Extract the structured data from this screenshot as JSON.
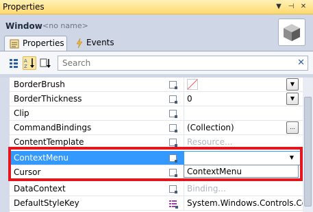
{
  "panel": {
    "title": "Properties",
    "pin_glyph": "▼",
    "dock_glyph": "⊣",
    "close_glyph": "✕"
  },
  "object": {
    "type": "Window",
    "name": "<no name>"
  },
  "tabs": [
    {
      "label": "Properties",
      "icon": "properties-icon",
      "active": true
    },
    {
      "label": "Events",
      "icon": "lightning-icon",
      "active": false
    }
  ],
  "toolbar": {
    "search_placeholder": "Search",
    "clear_glyph": "✕"
  },
  "grid": {
    "rows": [
      {
        "name": "BorderBrush",
        "value": "",
        "editor": "dropdown"
      },
      {
        "name": "BorderThickness",
        "value": "0",
        "editor": "dropdown"
      },
      {
        "name": "Clip",
        "value": ""
      },
      {
        "name": "CommandBindings",
        "value": "(Collection)",
        "editor": "ellipsis",
        "button_label": "..."
      },
      {
        "name": "ContentTemplate",
        "value": "Resource...",
        "ghost": true
      },
      {
        "name": "ContextMenu",
        "value": "",
        "editor": "dropdown",
        "selected": true
      },
      {
        "name": "Cursor",
        "value": ""
      },
      {
        "name": "DataContext",
        "value": "Binding...",
        "ghost": true
      },
      {
        "name": "DefaultStyleKey",
        "value": "System.Windows.Controls.Cor"
      }
    ],
    "dropdown_options": [
      "ContextMenu"
    ]
  },
  "colors": {
    "selection": "#3399ff",
    "highlight": "#e3161f",
    "title_bar": "#ffd96d"
  }
}
